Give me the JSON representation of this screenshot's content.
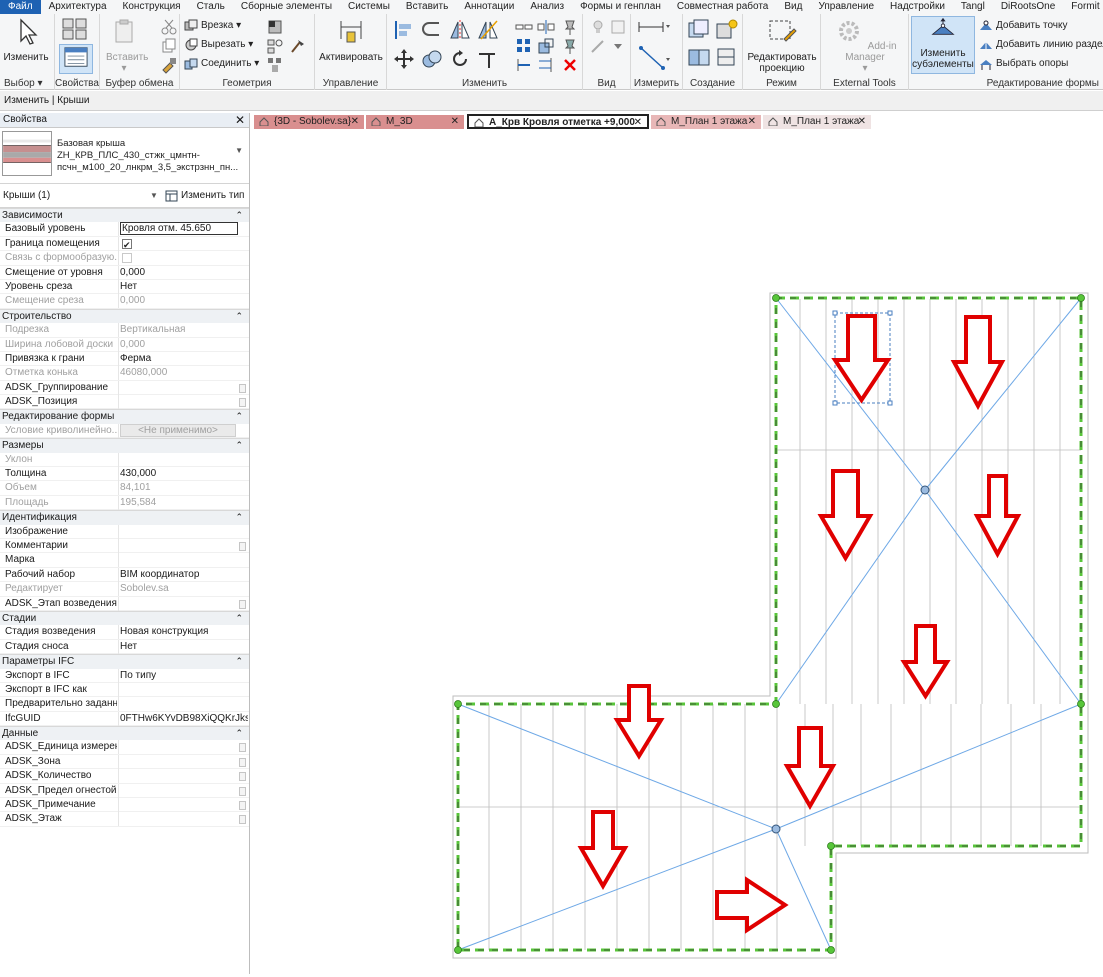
{
  "menubar": {
    "items": [
      "Файл",
      "Архитектура",
      "Конструкция",
      "Сталь",
      "Сборные элементы",
      "Системы",
      "Вставить",
      "Аннотации",
      "Анализ",
      "Формы и генплан",
      "Совместная работа",
      "Вид",
      "Управление",
      "Надстройки",
      "Tangl",
      "DiRootsOne",
      "Formit Exporter"
    ]
  },
  "ribbon": {
    "modify": "Изменить",
    "select_label": "Выбор",
    "properties_label": "Свойства",
    "paste": "Вставить",
    "clipboard_label": "Буфер обмена",
    "cut_label": "Врезка",
    "cutout_label": "Вырезать",
    "join_label": "Соединить",
    "geometry_label": "Геометрия",
    "activate": "Активировать",
    "manage_label": "Управление",
    "modify_panel_label": "Изменить",
    "view_label": "Вид",
    "measure_label": "Измерить",
    "create_label": "Создание",
    "edit_projection": "Редактировать проекцию",
    "mode_label": "Режим",
    "addin_manager": "Add-in Manager",
    "external_tools_label": "External Tools",
    "edit_subelements": "Изменить субэлементы",
    "add_point": "Добавить точку",
    "add_split_line": "Добавить линию раздел",
    "pick_supports": "Выбрать опоры",
    "shape_editing_label": "Редактирование формы"
  },
  "context": {
    "text": "Изменить | Крыши"
  },
  "properties": {
    "title": "Свойства",
    "type_name": "Базовая крыша",
    "type_detail_1": "ZH_КРВ_ПЛС_430_стжк_цмнтн-",
    "type_detail_2": "псчн_м100_20_лнкрм_3,5_экстрзнн_пн...",
    "instance_label": "Крыши (1)",
    "edit_type": "Изменить тип",
    "groups": [
      {
        "name": "Зависимости",
        "rows": [
          {
            "name": "Базовый уровень",
            "value": "Кровля отм. 45.650",
            "kind": "boxed"
          },
          {
            "name": "Граница помещения",
            "value": "",
            "kind": "check-on"
          },
          {
            "name": "Связь с формообразую...",
            "value": "",
            "kind": "check-off",
            "ro": true
          },
          {
            "name": "Смещение от уровня",
            "value": "0,000"
          },
          {
            "name": "Уровень среза",
            "value": "Нет"
          },
          {
            "name": "Смещение среза",
            "value": "0,000",
            "ro": true
          }
        ]
      },
      {
        "name": "Строительство",
        "rows": [
          {
            "name": "Подрезка",
            "value": "Вертикальная",
            "ro": true
          },
          {
            "name": "Ширина лобовой доски",
            "value": "0,000",
            "ro": true
          },
          {
            "name": "Привязка к грани",
            "value": "Ферма"
          },
          {
            "name": "Отметка конька",
            "value": "46080,000",
            "ro": true
          },
          {
            "name": "ADSK_Группирование",
            "value": "",
            "mini": true
          },
          {
            "name": "ADSK_Позиция",
            "value": "",
            "mini": true
          }
        ]
      },
      {
        "name": "Редактирование формы",
        "rows": [
          {
            "name": "Условие криволинейно...",
            "value": "<Не применимо>",
            "kind": "btn",
            "ro": true
          }
        ]
      },
      {
        "name": "Размеры",
        "rows": [
          {
            "name": "Уклон",
            "value": "",
            "ro": true
          },
          {
            "name": "Толщина",
            "value": "430,000"
          },
          {
            "name": "Объем",
            "value": "84,101",
            "ro": true
          },
          {
            "name": "Площадь",
            "value": "195,584",
            "ro": true
          }
        ]
      },
      {
        "name": "Идентификация",
        "rows": [
          {
            "name": "Изображение",
            "value": ""
          },
          {
            "name": "Комментарии",
            "value": "",
            "mini": true
          },
          {
            "name": "Марка",
            "value": ""
          },
          {
            "name": "Рабочий набор",
            "value": "BIM координатор"
          },
          {
            "name": "Редактирует",
            "value": "Sobolev.sa",
            "ro": true
          },
          {
            "name": "ADSK_Этап возведения",
            "value": "",
            "mini": true
          }
        ]
      },
      {
        "name": "Стадии",
        "rows": [
          {
            "name": "Стадия возведения",
            "value": "Новая конструкция"
          },
          {
            "name": "Стадия сноса",
            "value": "Нет"
          }
        ]
      },
      {
        "name": "Параметры IFC",
        "rows": [
          {
            "name": "Экспорт в IFC",
            "value": "По типу"
          },
          {
            "name": "Экспорт в IFC как",
            "value": ""
          },
          {
            "name": "Предварительно заданн...",
            "value": ""
          },
          {
            "name": "IfcGUID",
            "value": "0FTHw6KYvDB98XiQQKrJks"
          }
        ]
      },
      {
        "name": "Данные",
        "rows": [
          {
            "name": "ADSK_Единица измерен...",
            "value": "",
            "mini": true
          },
          {
            "name": "ADSK_Зона",
            "value": "",
            "mini": true
          },
          {
            "name": "ADSK_Количество",
            "value": "",
            "mini": true
          },
          {
            "name": "ADSK_Предел огнестой...",
            "value": "",
            "mini": true
          },
          {
            "name": "ADSK_Примечание",
            "value": "",
            "mini": true
          },
          {
            "name": "ADSK_Этаж",
            "value": "",
            "mini": true
          }
        ]
      }
    ]
  },
  "tabs": [
    {
      "label": "{3D - Sobolev.sa}",
      "active": false,
      "color": "#d98f8f"
    },
    {
      "label": "М_3D",
      "active": false,
      "color": "#d98f8f"
    },
    {
      "label": "А_Крв Кровля отметка +9,000",
      "active": true,
      "color": "#d98f8f"
    },
    {
      "label": "М_План 1 этажа",
      "active": false,
      "color": "#e8b7b7"
    },
    {
      "label": "М_План 1 этажа",
      "active": false,
      "color": "#efe3e3"
    }
  ],
  "colors": {
    "accent": "#1e62b3",
    "arrow": "#e00000",
    "boundary": "#58c63a",
    "ridge": "#6ea8e6"
  }
}
